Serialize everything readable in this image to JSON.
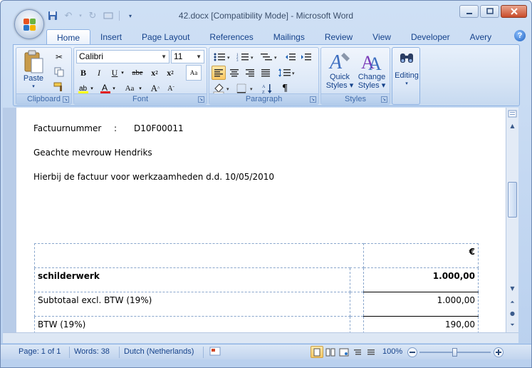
{
  "window": {
    "title": "42.docx [Compatibility Mode] - Microsoft Word"
  },
  "tabs": [
    "Home",
    "Insert",
    "Page Layout",
    "References",
    "Mailings",
    "Review",
    "View",
    "Developer",
    "Avery"
  ],
  "active_tab": "Home",
  "ribbon": {
    "clipboard": {
      "label": "Clipboard",
      "paste_label": "Paste"
    },
    "font": {
      "label": "Font",
      "font_name": "Calibri",
      "font_size": "11"
    },
    "paragraph": {
      "label": "Paragraph"
    },
    "styles": {
      "label": "Styles",
      "quick_styles_line1": "Quick",
      "quick_styles_line2": "Styles",
      "change_styles_line1": "Change",
      "change_styles_line2": "Styles"
    },
    "editing": {
      "label": "Editing"
    }
  },
  "document": {
    "invoice_label": "Factuurnummer",
    "invoice_colon": ":",
    "invoice_number": "D10F00011",
    "salutation": "Geachte mevrouw Hendriks",
    "intro": "Hierbij de factuur voor werkzaamheden d.d. 10/05/2010",
    "table": {
      "currency": "€",
      "rows": [
        {
          "label": "schilderwerk",
          "value": "1.000,00",
          "bold": true
        },
        {
          "label": "Subtotaal excl. BTW (19%)",
          "value": "1.000,00",
          "bold": false
        },
        {
          "label": "BTW (19%)",
          "value": "190,00",
          "bold": false
        }
      ]
    }
  },
  "status": {
    "page": "Page: 1 of 1",
    "words": "Words: 38",
    "language": "Dutch (Netherlands)",
    "zoom": "100%"
  },
  "colors": {
    "ribbon_text": "#15428b",
    "frame": "#6f8ab5",
    "close_button": "#c94b2a"
  }
}
